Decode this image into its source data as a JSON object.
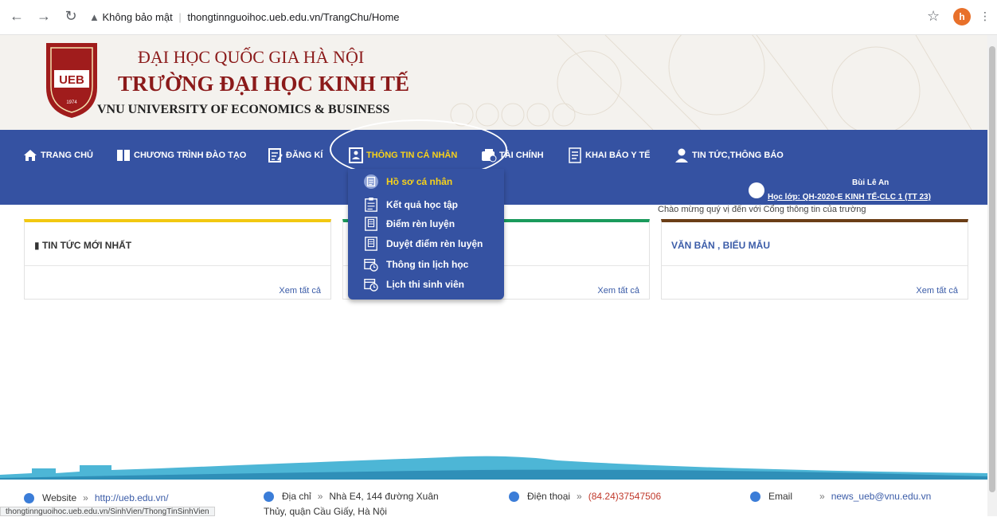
{
  "browser": {
    "security_label": "Không bảo mật",
    "url": "thongtinnguoihoc.ueb.edu.vn/TrangChu/Home",
    "profile_initial": "h"
  },
  "header": {
    "line1": "ĐẠI HỌC QUỐC GIA HÀ NỘI",
    "line2": "TRƯỜNG ĐẠI HỌC KINH TẾ",
    "line3": "VNU UNIVERSITY OF ECONOMICS & BUSINESS",
    "logo_text": "UEB",
    "logo_year": "1974"
  },
  "nav": {
    "items": [
      {
        "label": "TRANG CHỦ",
        "icon": "home-icon"
      },
      {
        "label": "CHƯƠNG TRÌNH ĐÀO TẠO",
        "icon": "book-icon"
      },
      {
        "label": "ĐĂNG KÍ",
        "icon": "register-icon"
      },
      {
        "label": "THÔNG TIN CÁ NHÂN",
        "icon": "id-card-icon"
      },
      {
        "label": "TÀI CHÍNH",
        "icon": "wallet-icon"
      },
      {
        "label": "KHAI BÁO Y TẾ",
        "icon": "document-icon"
      },
      {
        "label": "TIN TỨC,THÔNG BÁO",
        "icon": "user-tie-icon"
      }
    ]
  },
  "dropdown": {
    "items": [
      {
        "label": "Hồ sơ cá nhân",
        "icon": "id-card-icon"
      },
      {
        "label": "Kết quả học tập",
        "icon": "clipboard-icon"
      },
      {
        "label": "Điểm rèn luyện",
        "icon": "id-card-icon"
      },
      {
        "label": "Duyệt điểm rèn luyện",
        "icon": "id-card-icon"
      },
      {
        "label": "Thông tin lịch học",
        "icon": "calendar-clock-icon"
      },
      {
        "label": "Lịch thi sinh viên",
        "icon": "calendar-clock-icon"
      }
    ]
  },
  "user": {
    "name": "Bùi Lê An",
    "class_label": "Học lớp: QH-2020-E KINH TẾ-CLC 1 (TT 23)",
    "welcome": "Chào mừng quý vị đến với Cổng thông tin của trường"
  },
  "cards": [
    {
      "title": "TIN TỨC MỚI NHẤT",
      "more": "Xem tất cả"
    },
    {
      "title": "",
      "more": "Xem tất cả"
    },
    {
      "title": "VĂN BẢN , BIỂU MẪU",
      "more": "Xem tất cả"
    }
  ],
  "footer": {
    "website_label": "Website",
    "website_value": "http://ueb.edu.vn/",
    "address_label": "Địa chỉ",
    "address_value": "Nhà E4, 144 đường Xuân",
    "address_value2": "Thủy, quận Cầu Giấy, Hà Nội",
    "phone_label": "Điện thoại",
    "phone_value": "(84.24)37547506",
    "email_label": "Email",
    "email_value": "news_ueb@vnu.edu.vn",
    "arrow": "»"
  },
  "status_url": "thongtinnguoihoc.ueb.edu.vn/SinhVien/ThongTinSinhVien",
  "colors": {
    "nav_bg": "#3552a2",
    "accent_yellow": "#f7d21a",
    "brand_red": "#8b1a1a"
  }
}
